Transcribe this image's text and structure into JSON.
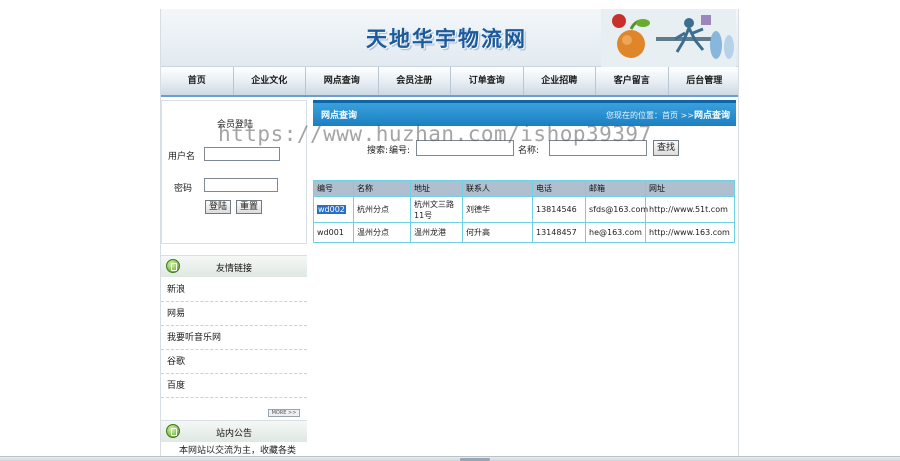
{
  "site_title": "天地华宇物流网",
  "nav": [
    "首页",
    "企业文化",
    "网点查询",
    "会员注册",
    "订单查询",
    "企业招聘",
    "客户留言",
    "后台管理"
  ],
  "login": {
    "heading": "会员登陆",
    "username_label": "用户名",
    "password_label": "密码",
    "login_button": "登陆",
    "reset_button": "重置"
  },
  "links_panel": {
    "title": "友情链接",
    "items": [
      "新浪",
      "网易",
      "我要听音乐网",
      "谷歌",
      "百度"
    ],
    "more_label": "MORE >>"
  },
  "notice_panel": {
    "title": "站内公告",
    "text": "本网站以交流为主，收藏各类动漫作品，也可由会员申请自行上传。有意者请联系管理员。"
  },
  "main": {
    "title": "网点查询",
    "location_prefix": "您现在的位置：首页 >>",
    "location_current": "网点查询",
    "search_label": "搜索:",
    "id_label": "编号:",
    "name_label": "名称:",
    "search_button": "查找",
    "table": {
      "headers": [
        "编号",
        "名称",
        "地址",
        "联系人",
        "电话",
        "邮箱",
        "网址"
      ],
      "rows": [
        [
          "wd002",
          "杭州分点",
          "杭州文三路11号",
          "刘德华",
          "13814546",
          "sfds@163.com",
          "http://www.51t.com"
        ],
        [
          "wd001",
          "温州分点",
          "温州龙港",
          "何升高",
          "13148457",
          "he@163.com",
          "http://www.163.com"
        ]
      ]
    }
  },
  "watermark": "https://www.huzhan.com/ishop39397"
}
